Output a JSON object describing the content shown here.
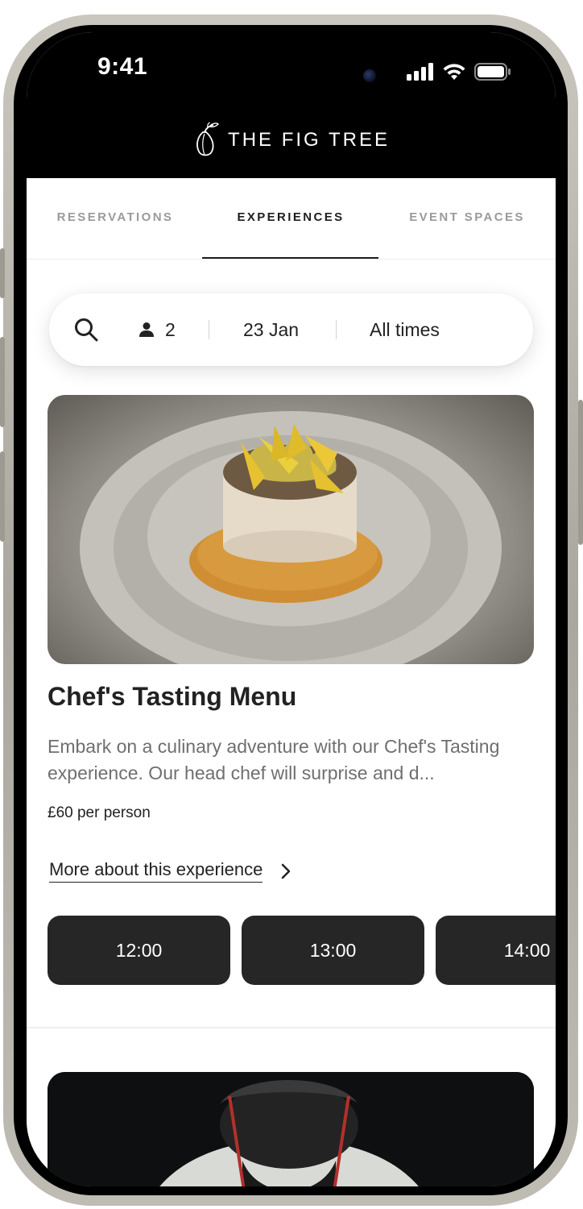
{
  "status_bar": {
    "time": "9:41"
  },
  "brand": {
    "name": "THE FIG TREE"
  },
  "tabs": [
    {
      "label": "RESERVATIONS",
      "active": false
    },
    {
      "label": "EXPERIENCES",
      "active": true
    },
    {
      "label": "EVENT SPACES",
      "active": false
    }
  ],
  "search": {
    "guests": "2",
    "date": "23 Jan",
    "time": "All times"
  },
  "experience": {
    "title": "Chef's Tasting Menu",
    "description": "Embark on a culinary adventure with our Chef's Tasting experience. Our head chef will surprise and d...",
    "price": "£60 per person",
    "more_link": "More about this experience",
    "time_slots": [
      "12:00",
      "13:00",
      "14:00"
    ]
  },
  "colors": {
    "accent": "#262626",
    "muted_text": "#6f6f6f",
    "tab_inactive": "#9a9a9a"
  }
}
